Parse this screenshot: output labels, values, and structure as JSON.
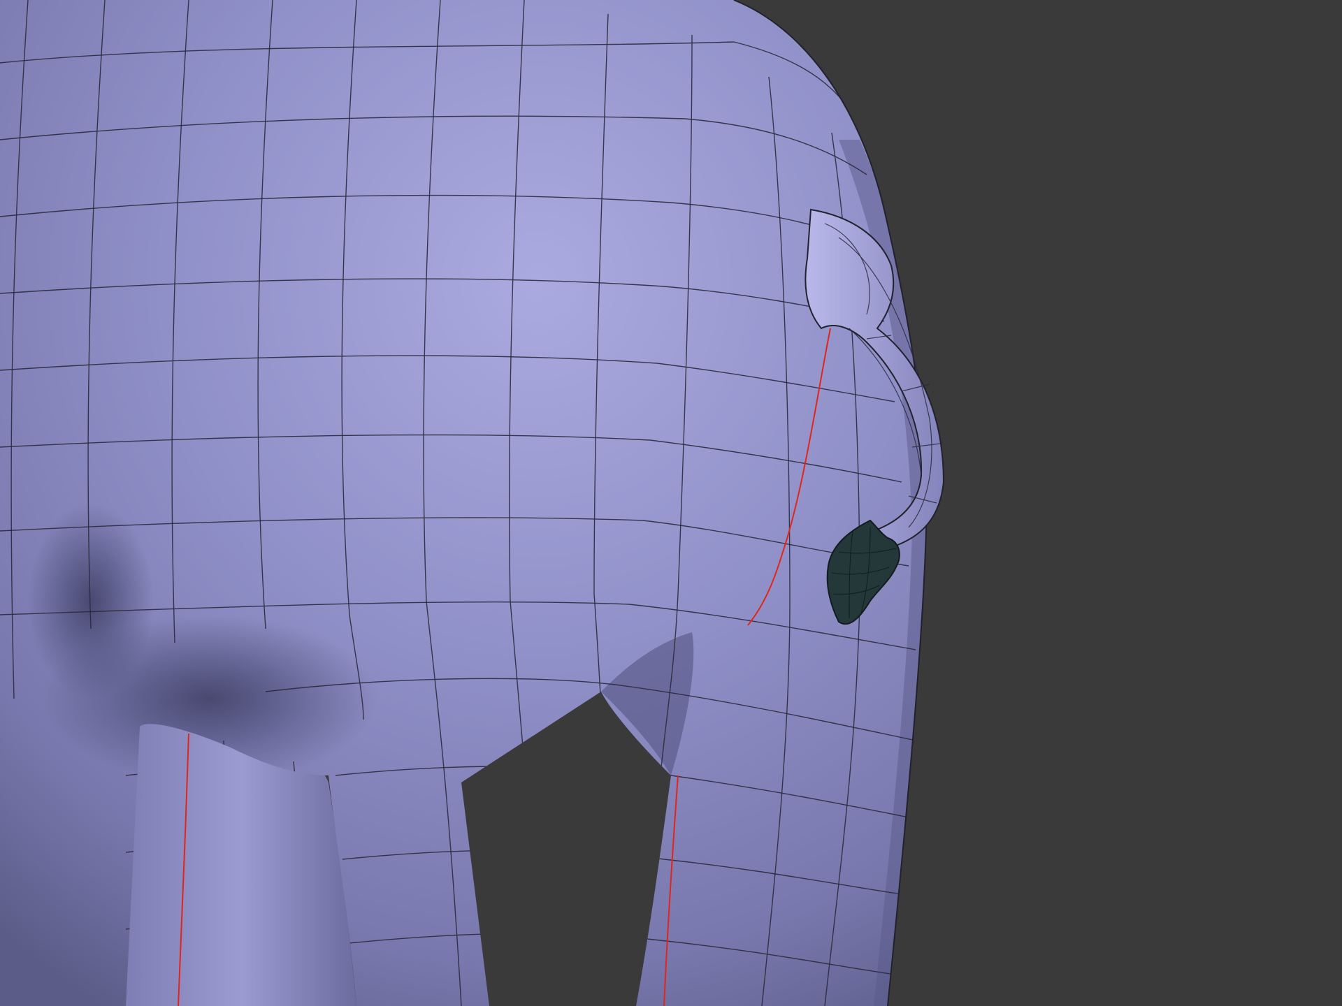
{
  "scene": {
    "subject": "elephant-rear-wireframe",
    "colors": {
      "background": "#3a3a3a",
      "body_light": "#a8a8de",
      "body_mid": "#8d8dc3",
      "body_dark": "#5c5c88",
      "wire": "#2a2a3c",
      "seam": "#e0261b",
      "tail_tuft": "#24383a"
    },
    "parts": [
      "rump",
      "left-hind-leg",
      "right-hind-leg",
      "far-leg",
      "tail",
      "tail-tuft",
      "uv-seams"
    ]
  }
}
